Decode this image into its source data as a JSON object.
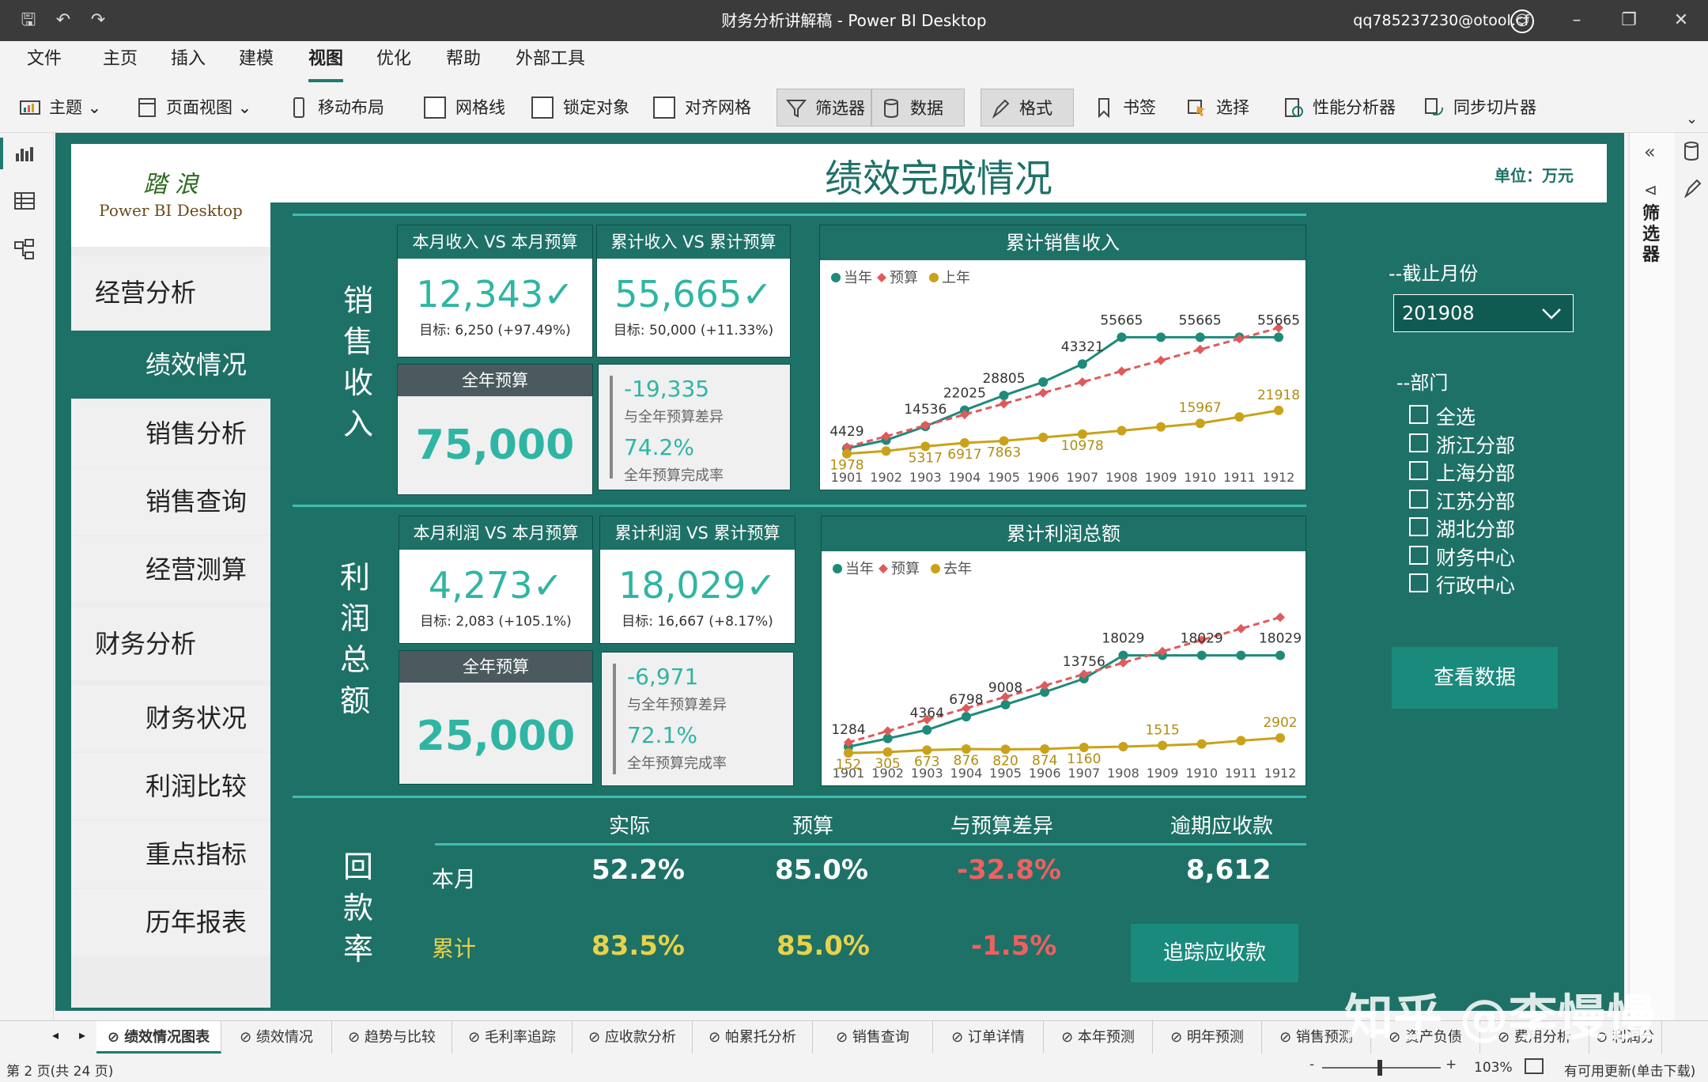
{
  "window": {
    "title": "财务分析讲解稿 - Power BI Desktop",
    "user": "qq785237230@otool.cf"
  },
  "menu": [
    "文件",
    "主页",
    "插入",
    "建模",
    "视图",
    "优化",
    "帮助",
    "外部工具"
  ],
  "ribbon": {
    "theme": "主题",
    "page_view": "页面视图",
    "mobile": "移动布局",
    "grid": "网格线",
    "lock": "锁定对象",
    "snap": "对齐网格",
    "filter": "筛选器",
    "data": "数据",
    "format": "格式",
    "bookmark": "书签",
    "selection": "选择",
    "perf": "性能分析器",
    "sync": "同步切片器"
  },
  "logo": {
    "cn": "踏 浪",
    "en": "Power BI Desktop"
  },
  "nav": {
    "m1": "经营分析",
    "s1": "绩效情况",
    "s2": "销售分析",
    "s3": "销售查询",
    "s4": "经营测算",
    "m2": "财务分析",
    "s5": "财务状况",
    "s6": "利润比较",
    "s7": "重点指标",
    "s8": "历年报表"
  },
  "report": {
    "title": "绩效完成情况",
    "unit": "单位：万元"
  },
  "sales": {
    "section": "销售收入",
    "kpi1_hd": "本月收入 VS 本月预算",
    "kpi1_val": "12,343✓",
    "kpi1_tgt": "目标: 6,250 (+97.49%)",
    "kpi2_hd": "累计收入 VS 累计预算",
    "kpi2_val": "55,665✓",
    "kpi2_tgt": "目标: 50,000 (+11.33%)",
    "bud_hd": "全年预算",
    "bud_val": "75,000",
    "diff_v": "-19,335",
    "diff_l": "与全年预算差异",
    "rate_v": "74.2%",
    "rate_l": "全年预算完成率"
  },
  "profit": {
    "section": "利润总额",
    "kpi1_hd": "本月利润 VS 本月预算",
    "kpi1_val": "4,273✓",
    "kpi1_tgt": "目标: 2,083 (+105.1%)",
    "kpi2_hd": "累计利润 VS 累计预算",
    "kpi2_val": "18,029✓",
    "kpi2_tgt": "目标: 16,667 (+8.17%)",
    "bud_hd": "全年预算",
    "bud_val": "25,000",
    "diff_v": "-6,971",
    "diff_l": "与全年预算差异",
    "rate_v": "72.1%",
    "rate_l": "全年预算完成率"
  },
  "chart_data": [
    {
      "type": "line",
      "title": "累计销售收入",
      "legend": [
        "当年",
        "预算",
        "上年"
      ],
      "categories": [
        "1901",
        "1902",
        "1903",
        "1904",
        "1905",
        "1906",
        "1907",
        "1908",
        "1909",
        "1910",
        "1911",
        "1912"
      ],
      "series": [
        {
          "name": "当年",
          "values": [
            4429,
            8200,
            14536,
            22025,
            28805,
            35000,
            43321,
            55665,
            55665,
            55665,
            55665,
            55665
          ],
          "color": "#1e8a7a"
        },
        {
          "name": "预算",
          "values": [
            5000,
            10000,
            15000,
            20000,
            25000,
            30000,
            35000,
            40000,
            45000,
            50000,
            55000,
            60000
          ],
          "color": "#e05a5a"
        },
        {
          "name": "上年",
          "values": [
            1978,
            3200,
            5317,
            6917,
            7863,
            9500,
            10978,
            12600,
            14300,
            15967,
            18900,
            21918
          ],
          "color": "#c9a21a"
        }
      ],
      "labels_cur": [
        "4429",
        "",
        "14536",
        "22025",
        "28805",
        "",
        "43321",
        "55665",
        "",
        "55665",
        "",
        "55665"
      ],
      "labels_prev": [
        "1978",
        "",
        "5317",
        "6917",
        "7863",
        "",
        "10978",
        "",
        "",
        "15967",
        "",
        "21918"
      ],
      "ymax": 62000
    },
    {
      "type": "line",
      "title": "累计利润总额",
      "legend": [
        "当年",
        "预算",
        "去年"
      ],
      "categories": [
        "1901",
        "1902",
        "1903",
        "1904",
        "1905",
        "1906",
        "1907",
        "1908",
        "1909",
        "1910",
        "1911",
        "1912"
      ],
      "series": [
        {
          "name": "当年",
          "values": [
            1284,
            2800,
            4364,
            6798,
            9008,
            11300,
            13756,
            18029,
            18029,
            18029,
            18029,
            18029
          ],
          "color": "#1e8a7a"
        },
        {
          "name": "预算",
          "values": [
            2083,
            4167,
            6250,
            8333,
            10417,
            12500,
            14583,
            16667,
            18750,
            20833,
            22917,
            25000
          ],
          "color": "#e05a5a"
        },
        {
          "name": "去年",
          "values": [
            152,
            305,
            673,
            876,
            820,
            874,
            1160,
            1300,
            1515,
            1800,
            2400,
            2902
          ],
          "color": "#c9a21a"
        }
      ],
      "labels_cur": [
        "1284",
        "",
        "4364",
        "6798",
        "9008",
        "",
        "13756",
        "18029",
        "",
        "18029",
        "",
        "18029"
      ],
      "labels_prev": [
        "152",
        "305",
        "673",
        "876",
        "820",
        "874",
        "1160",
        "",
        "1515",
        "",
        "",
        "2902"
      ],
      "ymax": 25500
    }
  ],
  "slicer": {
    "month_label": "--截止月份",
    "month_val": "201908",
    "dept_label": "--部门",
    "depts": [
      "全选",
      "浙江分部",
      "上海分部",
      "江苏分部",
      "湖北分部",
      "财务中心",
      "行政中心"
    ],
    "btn": "查看数据"
  },
  "collect": {
    "section": "回款率",
    "h1": "实际",
    "h2": "预算",
    "h3": "与预算差异",
    "h4": "逾期应收款",
    "r1": "本月",
    "r1a": "52.2%",
    "r1b": "85.0%",
    "r1c": "-32.8%",
    "r1d": "8,612",
    "r2": "累计",
    "r2a": "83.5%",
    "r2b": "85.0%",
    "r2c": "-1.5%",
    "btn": "追踪应收款"
  },
  "filters_pane": "筛选器",
  "tabs": [
    "绩效情况图表",
    "绩效情况",
    "趋势与比较",
    "毛利率追踪",
    "应收款分析",
    "帕累托分析",
    "销售查询",
    "订单详情",
    "本年预测",
    "明年预测",
    "销售预测",
    "资产负债",
    "费用分析",
    "利润分"
  ],
  "status": {
    "page": "第 2 页(共 24 页)",
    "zoom": "103%",
    "update": "有可用更新(单击下载)"
  },
  "watermark": "知乎 @李慢慢"
}
